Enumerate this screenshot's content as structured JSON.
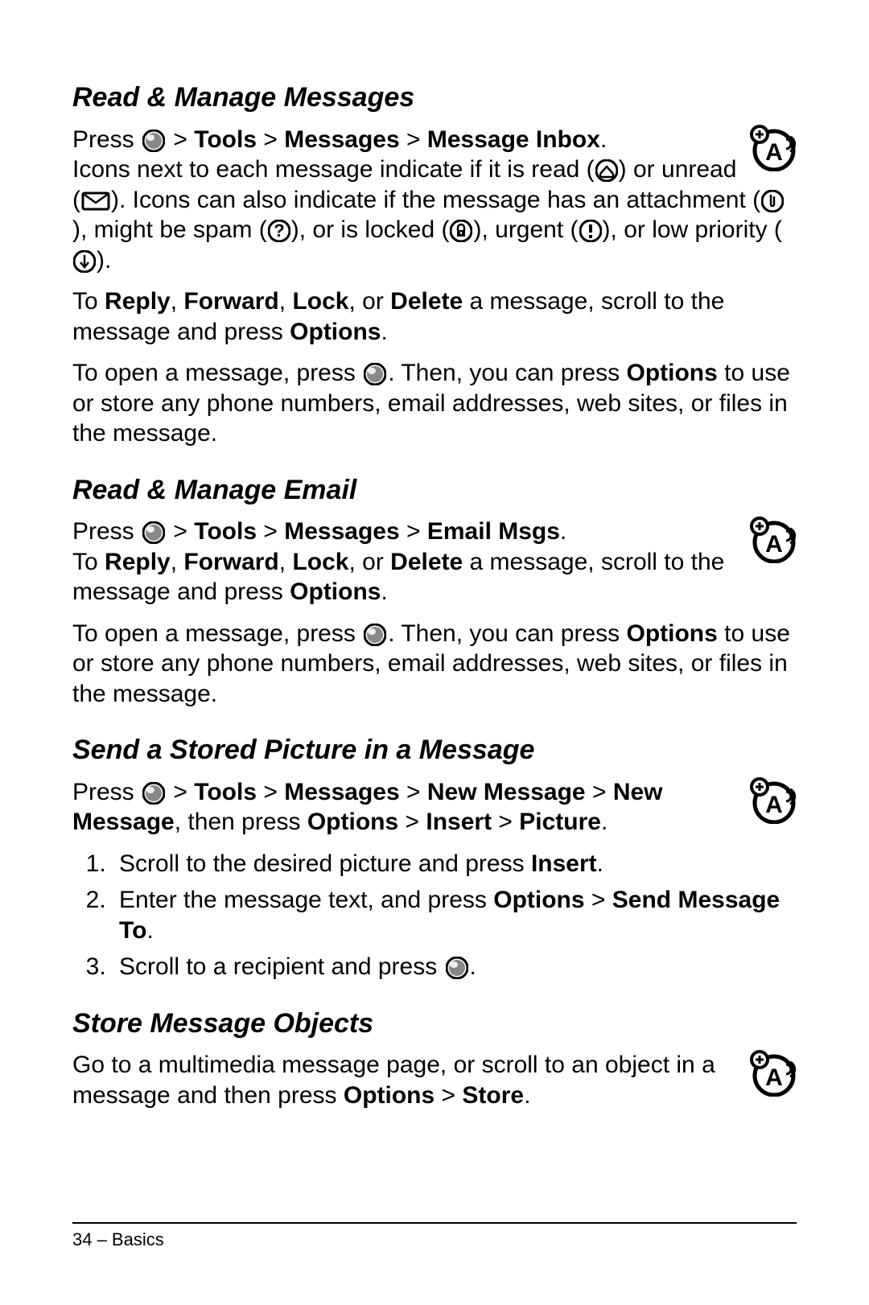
{
  "sections": {
    "s1": {
      "title": "Read & Manage Messages",
      "press": "Press ",
      "path1": "Tools",
      "path2": "Messages",
      "path3": "Message Inbox",
      "icons_intro": "Icons next to each message indicate if it is read (",
      "icons_after_read": ") or unread (",
      "icons_after_unread": "). Icons can also indicate if the message has an attachment (",
      "icons_after_attach": "), might be spam (",
      "icons_after_spam": "), or is locked (",
      "icons_after_lock": "), urgent (",
      "icons_after_urgent": "), or low priority (",
      "icons_end": ").",
      "actions_intro_to": "To ",
      "actions_reply": "Reply",
      "actions_fwd": "Forward",
      "actions_lock": "Lock",
      "actions_or": ", or ",
      "actions_del": "Delete",
      "actions_after": " a message, scroll to the message and press ",
      "actions_options": "Options",
      "open_intro": "To open a message, press ",
      "open_after": ". Then, you can press ",
      "open_options": "Options",
      "open_end": " to use or store any phone numbers, email addresses, web sites, or files in the message."
    },
    "s2": {
      "title": "Read & Manage Email",
      "press": "Press ",
      "path1": "Tools",
      "path2": "Messages",
      "path3": "Email Msgs",
      "actions_intro_to": "To ",
      "actions_reply": "Reply",
      "actions_fwd": "Forward",
      "actions_lock": "Lock",
      "actions_or": ", or ",
      "actions_del": "Delete",
      "actions_after": " a message, scroll to the message and press ",
      "actions_options": "Options",
      "open_intro": "To open a message, press ",
      "open_after": ". Then, you can press ",
      "open_options": "Options",
      "open_end": " to use or store any phone numbers, email addresses, web sites, or files in the message."
    },
    "s3": {
      "title": "Send a Stored Picture in a Message",
      "press": "Press ",
      "path1": "Tools",
      "path2": "Messages",
      "path3": "New Message",
      "path4": "New Message",
      "then_press": ", then press ",
      "path5": "Options",
      "path6": "Insert",
      "path7": "Picture",
      "step1a": "Scroll to the desired picture and press ",
      "step1b": "Insert",
      "step2a": "Enter the message text, and press ",
      "step2b": "Options",
      "step2c": "Send Message To",
      "step3a": "Scroll to a recipient and press "
    },
    "s4": {
      "title": "Store Message Objects",
      "intro": "Go to a multimedia message page, or scroll to an object in a message and then press ",
      "options": "Options",
      "store": "Store"
    }
  },
  "footer": "34 – Basics",
  "sep": ", ",
  "gt": " > ",
  "period": "."
}
